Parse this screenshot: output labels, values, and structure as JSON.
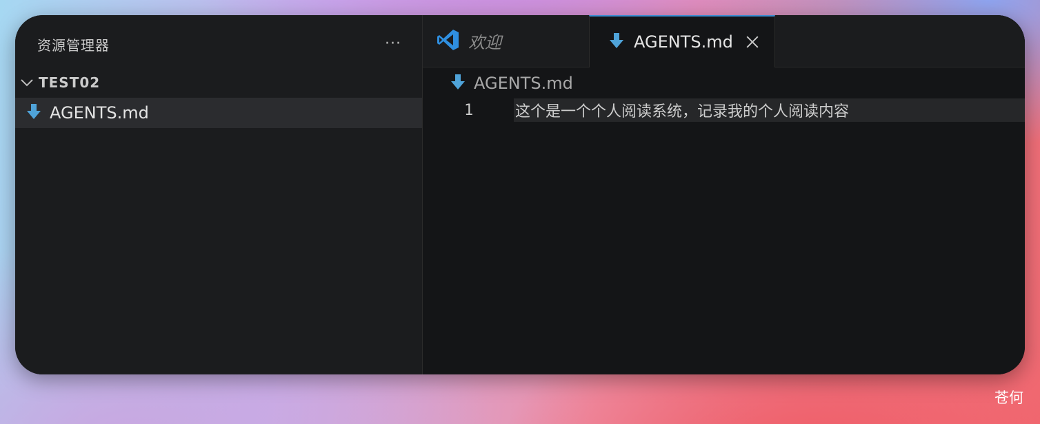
{
  "sidebar": {
    "title": "资源管理器",
    "more_label": "···",
    "folder": {
      "name": "TEST02",
      "expanded": true
    },
    "files": [
      {
        "name": "AGENTS.md",
        "icon": "markdown-download-icon",
        "selected": true
      }
    ]
  },
  "tabs": [
    {
      "label": "欢迎",
      "icon": "vscode-logo-icon",
      "active": false,
      "italic": true
    },
    {
      "label": "AGENTS.md",
      "icon": "markdown-download-icon",
      "active": true,
      "closable": true
    }
  ],
  "breadcrumb": {
    "label": "AGENTS.md",
    "icon": "markdown-download-icon"
  },
  "editor": {
    "lines": [
      {
        "number": "1",
        "text": "这个是一个个人阅读系统，记录我的个人阅读内容"
      }
    ]
  },
  "watermark": "苍何",
  "colors": {
    "accent": "#3b8fd4",
    "md_icon": "#4fa3d9",
    "vscode_blue": "#2f8fe0",
    "window_bg": "#181818"
  }
}
